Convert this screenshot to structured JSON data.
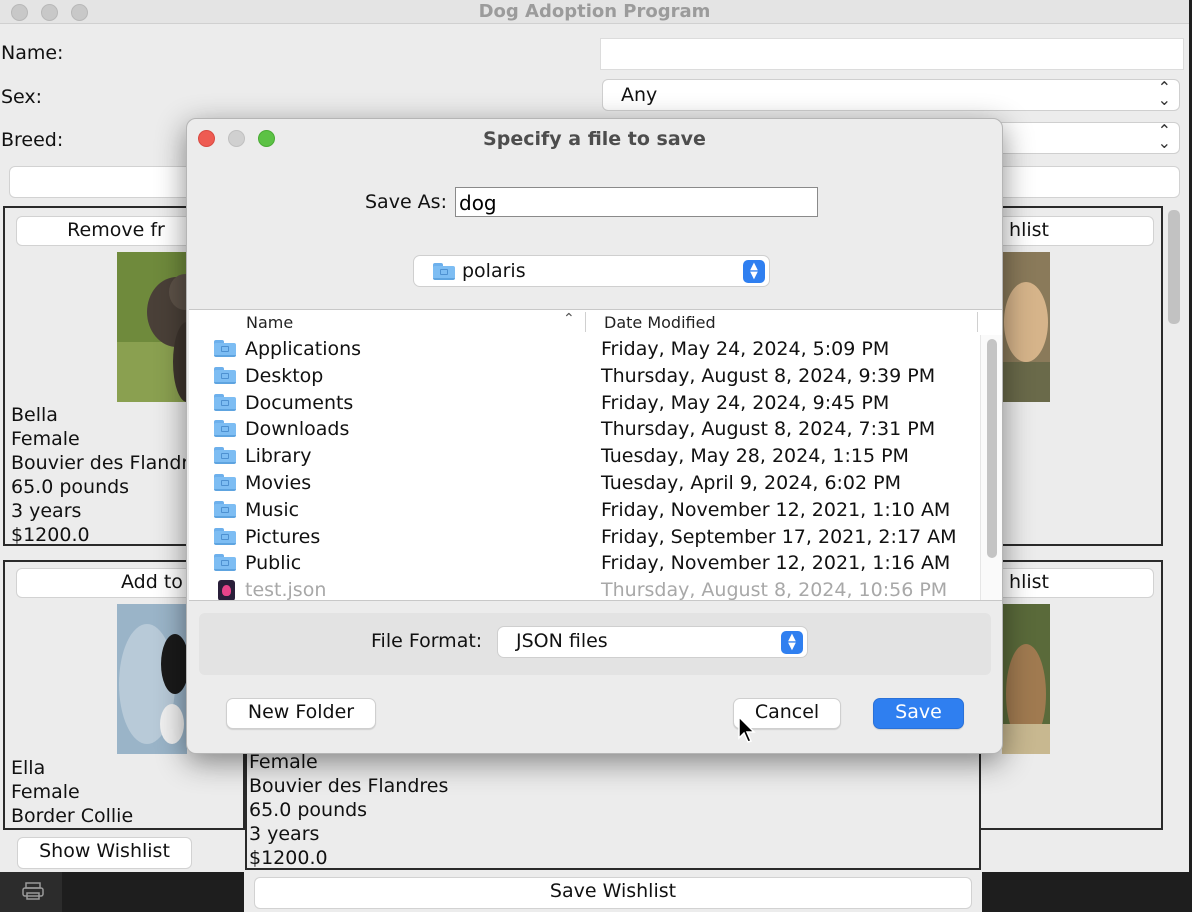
{
  "app": {
    "title": "Dog Adoption Program",
    "labels": {
      "name": "Name:",
      "sex": "Sex:",
      "breed": "Breed:"
    },
    "name_value": "",
    "sex_value": "Any",
    "breed_value": "",
    "cards": [
      {
        "button": "Remove fr",
        "name": "Bella",
        "sex": "Female",
        "breed": "Bouvier des Flandre",
        "weight": "65.0 pounds",
        "age": "3 years",
        "price": "$1200.0"
      },
      {
        "button": "hlist"
      },
      {
        "button": "Add to",
        "name": "Ella",
        "sex": "Female",
        "breed": "Border Collie"
      },
      {
        "button": "hlist"
      }
    ],
    "middle_card": {
      "sex": "Female",
      "breed": "Bouvier des Flandres",
      "weight": "65.0 pounds",
      "age": "3 years",
      "price": "$1200.0"
    },
    "show_wishlist": "Show Wishlist",
    "save_wishlist": "Save Wishlist"
  },
  "dialog": {
    "title": "Specify a file to save",
    "save_as_label": "Save As:",
    "save_as_value": "dog",
    "location": "polaris",
    "columns": {
      "name": "Name",
      "date": "Date Modified"
    },
    "files": [
      {
        "name": "Applications",
        "date": "Friday, May 24, 2024, 5:09 PM",
        "icon": "folder-icon"
      },
      {
        "name": "Desktop",
        "date": "Thursday, August 8, 2024, 9:39 PM",
        "icon": "folder-icon"
      },
      {
        "name": "Documents",
        "date": "Friday, May 24, 2024, 9:45 PM",
        "icon": "folder-icon"
      },
      {
        "name": "Downloads",
        "date": "Thursday, August 8, 2024, 7:31 PM",
        "icon": "folder-icon"
      },
      {
        "name": "Library",
        "date": "Tuesday, May 28, 2024, 1:15 PM",
        "icon": "folder-icon"
      },
      {
        "name": "Movies",
        "date": "Tuesday, April 9, 2024, 6:02 PM",
        "icon": "folder-icon"
      },
      {
        "name": "Music",
        "date": "Friday, November 12, 2021, 1:10 AM",
        "icon": "folder-icon"
      },
      {
        "name": "Pictures",
        "date": "Friday, September 17, 2021, 2:17 AM",
        "icon": "folder-icon"
      },
      {
        "name": "Public",
        "date": "Friday, November 12, 2021, 1:16 AM",
        "icon": "folder-icon"
      },
      {
        "name": "test.json",
        "date": "Thursday, August 8, 2024, 10:56 PM",
        "icon": "json-file-icon",
        "dimmed": true
      }
    ],
    "file_format_label": "File Format:",
    "file_format_value": "JSON files",
    "new_folder": "New Folder",
    "cancel": "Cancel",
    "save": "Save"
  },
  "colors": {
    "accent": "#2f7ff0",
    "close": "#ee5b52",
    "minimize": "#d0d0d0",
    "zoom": "#5cc245"
  }
}
